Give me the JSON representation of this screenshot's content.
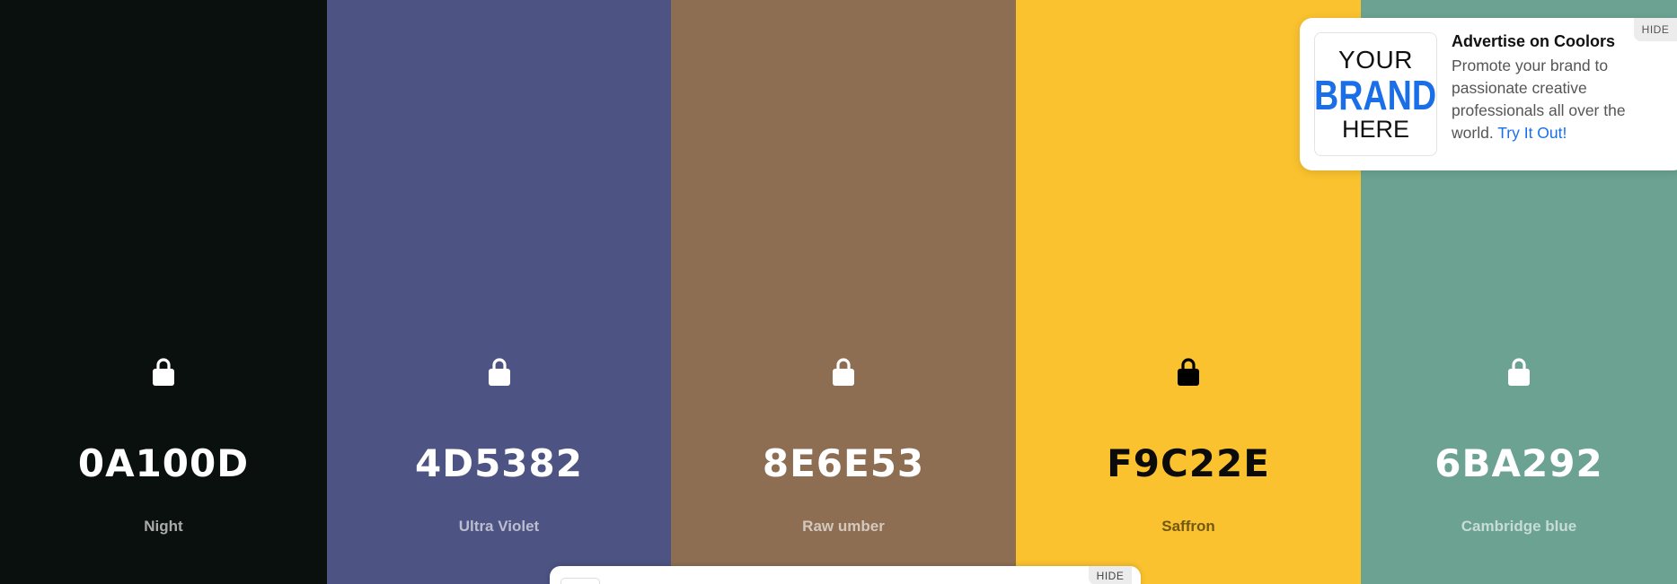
{
  "swatches": [
    {
      "hex": "0A100D",
      "name": "Night",
      "color": "#0A100D",
      "text_theme": "light",
      "lock_icon": "lock-icon"
    },
    {
      "hex": "4D5382",
      "name": "Ultra Violet",
      "color": "#4D5382",
      "text_theme": "light",
      "lock_icon": "lock-icon"
    },
    {
      "hex": "8E6E53",
      "name": "Raw umber",
      "color": "#8E6E53",
      "text_theme": "light",
      "lock_icon": "lock-icon"
    },
    {
      "hex": "F9C22E",
      "name": "Saffron",
      "color": "#F9C22E",
      "text_theme": "dark",
      "lock_icon": "lock-icon"
    },
    {
      "hex": "6BA292",
      "name": "Cambridge blue",
      "color": "#6BA292",
      "text_theme": "light",
      "lock_icon": "lock-icon"
    }
  ],
  "ad": {
    "logo_line1": "YOUR",
    "logo_line2": "BRAND",
    "logo_line3": "HERE",
    "title": "Advertise on Coolors",
    "body": "Promote your brand to passionate creative professionals all over the world.",
    "link": "Try It Out!",
    "hide_label": "HIDE",
    "link_color": "#1A6FE8"
  },
  "banner": {
    "hide_label": "HIDE"
  }
}
